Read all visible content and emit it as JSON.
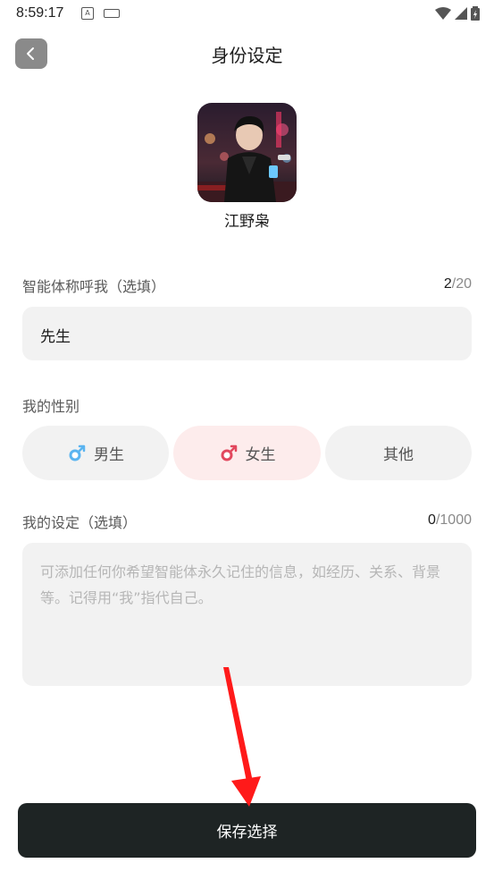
{
  "status_bar": {
    "time": "8:59:17"
  },
  "header": {
    "title": "身份设定"
  },
  "character": {
    "name": "江野枭"
  },
  "nickname": {
    "label": "智能体称呼我（选填）",
    "count": "2",
    "max": "/20",
    "value": "先生"
  },
  "gender": {
    "label": "我的性别",
    "options": [
      {
        "label": "男生",
        "icon": "male-symbol-icon"
      },
      {
        "label": "女生",
        "icon": "female-symbol-icon",
        "selected": true
      },
      {
        "label": "其他"
      }
    ]
  },
  "setting": {
    "label": "我的设定（选填）",
    "count": "0",
    "max": "/1000",
    "placeholder": "可添加任何你希望智能体永久记住的信息，如经历、关系、背景等。记得用“我”指代自己。"
  },
  "save_button": {
    "label": "保存选择"
  },
  "colors": {
    "save_button_bg": "#1e2424",
    "selected_gender_bg": "#fdecec",
    "annotation_arrow": "#ff1a1a"
  }
}
